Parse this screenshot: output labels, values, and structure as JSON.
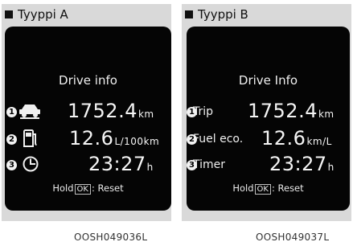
{
  "panel_a": {
    "header": "Tyyppi A",
    "title": "Drive info",
    "rows": [
      {
        "num": "1",
        "icon": "car-trip-icon",
        "value": "1752.4",
        "unit": "km"
      },
      {
        "num": "2",
        "icon": "fuel-pump-icon",
        "value": "12.6",
        "unit": "L/100km"
      },
      {
        "num": "3",
        "icon": "clock-icon",
        "value": "23:27",
        "unit": "h"
      }
    ],
    "hold_prefix": "Hold",
    "hold_key": "OK",
    "hold_suffix": ": Reset",
    "code": "OOSH049036L"
  },
  "panel_b": {
    "header": "Tyyppi B",
    "title": "Drive Info",
    "rows": [
      {
        "num": "1",
        "label": "Trip",
        "value": "1752.4",
        "unit": "km"
      },
      {
        "num": "2",
        "label": "Fuel eco.",
        "value": "12.6",
        "unit": "km/L"
      },
      {
        "num": "3",
        "label": "Timer",
        "value": "23:27",
        "unit": "h"
      }
    ],
    "hold_prefix": "Hold",
    "hold_key": "OK",
    "hold_suffix": ": Reset",
    "code": "OOSH049037L"
  }
}
